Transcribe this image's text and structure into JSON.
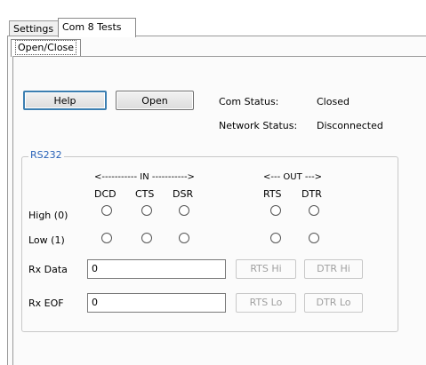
{
  "tabs": [
    {
      "label": "Settings",
      "active": false
    },
    {
      "label": "Com 8 Tests",
      "active": true
    }
  ],
  "subtab": {
    "label": "Open/Close"
  },
  "buttons": {
    "help": "Help",
    "open": "Open"
  },
  "status": {
    "com_label": "Com Status:",
    "com_value": "Closed",
    "network_label": "Network Status:",
    "network_value": "Disconnected"
  },
  "rs232": {
    "title": "RS232",
    "in_header": "<----------- IN ----------->",
    "out_header": "<--- OUT --->",
    "in_signals": [
      "DCD",
      "CTS",
      "DSR"
    ],
    "out_signals": [
      "RTS",
      "DTR"
    ],
    "rows": [
      "High (0)",
      "Low (1)"
    ],
    "rx_data_label": "Rx Data",
    "rx_data_value": "0",
    "rx_eof_label": "Rx EOF",
    "rx_eof_value": "0",
    "rts_hi": "RTS Hi",
    "dtr_hi": "DTR Hi",
    "rts_lo": "RTS Lo",
    "dtr_lo": "DTR Lo"
  },
  "colors": {
    "group_title": "#2a63b8",
    "focus_border": "#3c7fb1"
  }
}
